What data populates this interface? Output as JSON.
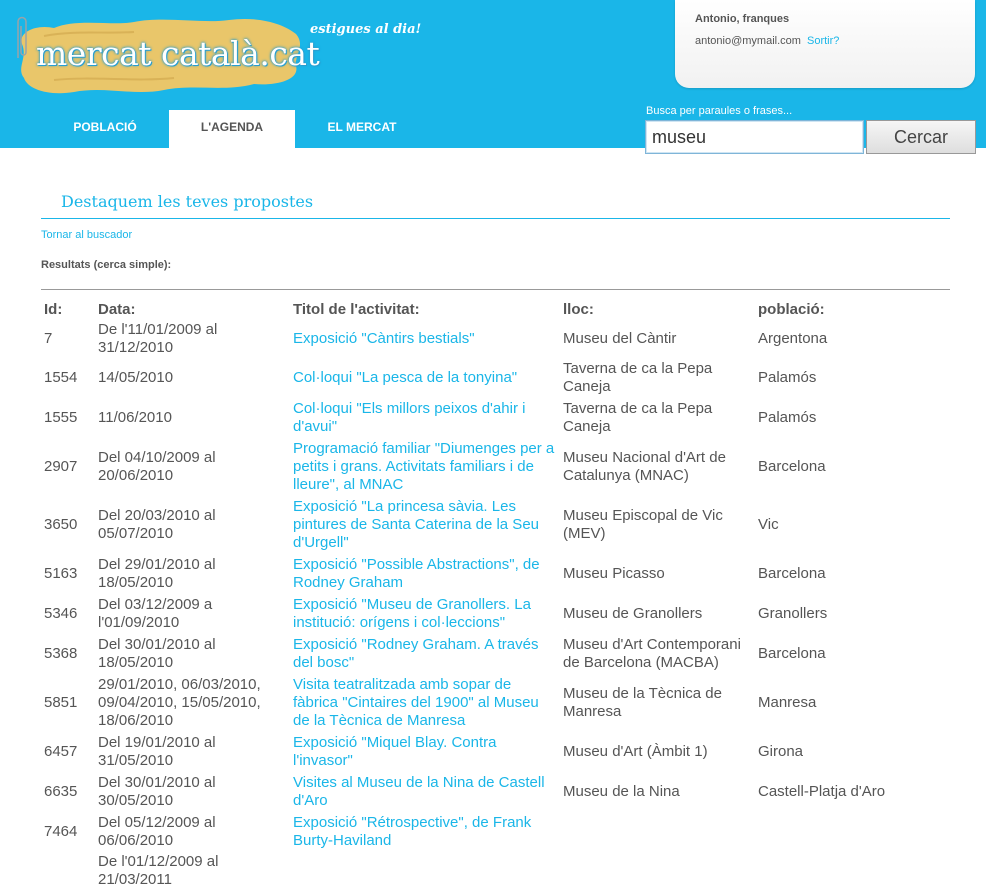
{
  "header": {
    "logo_text": "mercat català.cat",
    "tagline": "estigues al dia!"
  },
  "user": {
    "name": "Antonio, franques",
    "email": "antonio@mymail.com",
    "logout_label": "Sortir?"
  },
  "nav": {
    "tabs": [
      {
        "label": "POBLACIÓ",
        "active": false
      },
      {
        "label": "L'AGENDA",
        "active": true
      },
      {
        "label": "EL MERCAT",
        "active": false
      }
    ]
  },
  "search": {
    "label": "Busca per paraules o frases...",
    "value": "museu",
    "button_label": "Cercar"
  },
  "content": {
    "section_title": "Destaquem les teves propostes",
    "back_link": "Tornar al buscador",
    "results_label": "Resultats (cerca simple):",
    "columns": [
      "Id:",
      "Data:",
      "Titol de l'activitat:",
      "lloc:",
      "població:"
    ],
    "rows": [
      {
        "id": "7",
        "date": "De l'11/01/2009 al 31/12/2010",
        "title": "Exposició \"Càntirs bestials\"",
        "place": "Museu del Càntir",
        "town": "Argentona"
      },
      {
        "id": "1554",
        "date": "14/05/2010",
        "title": "Col·loqui \"La pesca de la tonyina\"",
        "place": "Taverna de ca la Pepa Caneja",
        "town": "Palamós"
      },
      {
        "id": "1555",
        "date": "11/06/2010",
        "title": "Col·loqui \"Els millors peixos d'ahir i d'avui\"",
        "place": "Taverna de ca la Pepa Caneja",
        "town": "Palamós"
      },
      {
        "id": "2907",
        "date": "Del 04/10/2009 al 20/06/2010",
        "title": "Programació familiar \"Diumenges per a petits i grans. Activitats familiars i de lleure\", al MNAC",
        "place": "Museu Nacional d'Art de Catalunya (MNAC)",
        "town": "Barcelona"
      },
      {
        "id": "3650",
        "date": "Del 20/03/2010 al 05/07/2010",
        "title": "Exposició \"La princesa sàvia. Les pintures de Santa Caterina de la Seu d'Urgell\"",
        "place": "Museu Episcopal de Vic (MEV)",
        "town": "Vic"
      },
      {
        "id": "5163",
        "date": "Del 29/01/2010 al 18/05/2010",
        "title": "Exposició \"Possible Abstractions\", de Rodney Graham",
        "place": "Museu Picasso",
        "town": "Barcelona"
      },
      {
        "id": "5346",
        "date": "Del 03/12/2009 a l'01/09/2010",
        "title": "Exposició \"Museu de Granollers. La institució: orígens i col·leccions\"",
        "place": "Museu de Granollers",
        "town": "Granollers"
      },
      {
        "id": "5368",
        "date": "Del 30/01/2010 al 18/05/2010",
        "title": "Exposició \"Rodney Graham. A través del bosc\"",
        "place": "Museu d'Art Contemporani de Barcelona (MACBA)",
        "town": "Barcelona"
      },
      {
        "id": "5851",
        "date": "29/01/2010, 06/03/2010, 09/04/2010, 15/05/2010, 18/06/2010",
        "title": "Visita teatralitzada amb sopar de fàbrica \"Cintaires del 1900\" al Museu de la Tècnica de Manresa",
        "place": "Museu de la Tècnica de Manresa",
        "town": "Manresa"
      },
      {
        "id": "6457",
        "date": "Del 19/01/2010 al 31/05/2010",
        "title": "Exposició \"Miquel Blay. Contra l'invasor\"",
        "place": "Museu d'Art (Àmbit 1)",
        "town": "Girona"
      },
      {
        "id": "6635",
        "date": "Del 30/01/2010 al 30/05/2010",
        "title": "Visites al Museu de la Nina de Castell d'Aro",
        "place": "Museu de la Nina",
        "town": "Castell-Platja d'Aro"
      },
      {
        "id": "7464",
        "date": "Del 05/12/2009 al 06/06/2010",
        "title": "Exposició \"Rétrospective\", de Frank Burty-Haviland",
        "place": "",
        "town": ""
      },
      {
        "id": "",
        "date": "De l'01/12/2009 al 21/03/2011",
        "title": "",
        "place": "",
        "town": ""
      }
    ]
  },
  "colors": {
    "brand_blue": "#1ab6e8",
    "logo_yellow": "#e9c66a",
    "text_gray": "#555555"
  }
}
